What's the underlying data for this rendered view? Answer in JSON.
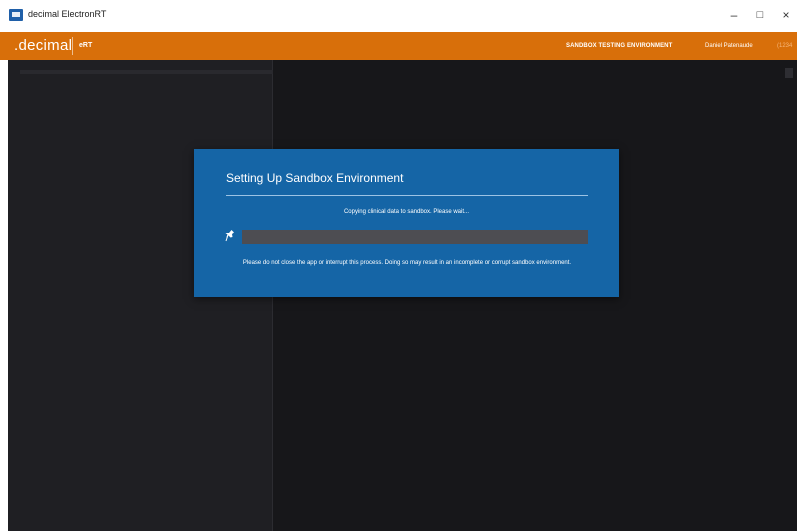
{
  "window": {
    "title": "decimal ElectronRT",
    "controls": {
      "minimize": "–",
      "maximize": "□",
      "close": "×"
    }
  },
  "header": {
    "logo": ".decimal",
    "product": "eRT",
    "environment": "SANDBOX TESTING ENVIRONMENT",
    "user_name": "Daniel Patenaude",
    "user_id": "(1234"
  },
  "modal": {
    "title": "Setting Up Sandbox Environment",
    "status": "Copying clinical data to sandbox. Please wait...",
    "progress": 0,
    "warning": "Please do not close the app or interrupt this process. Doing so may result in an incomplete or corrupt sandbox environment."
  },
  "icons": {
    "app": "app-logo-icon",
    "progress": "pin-icon"
  },
  "colors": {
    "header": "#d86f0a",
    "modal": "#1565a6",
    "background": "#1c1c20",
    "progress_track": "#4d4d52"
  }
}
